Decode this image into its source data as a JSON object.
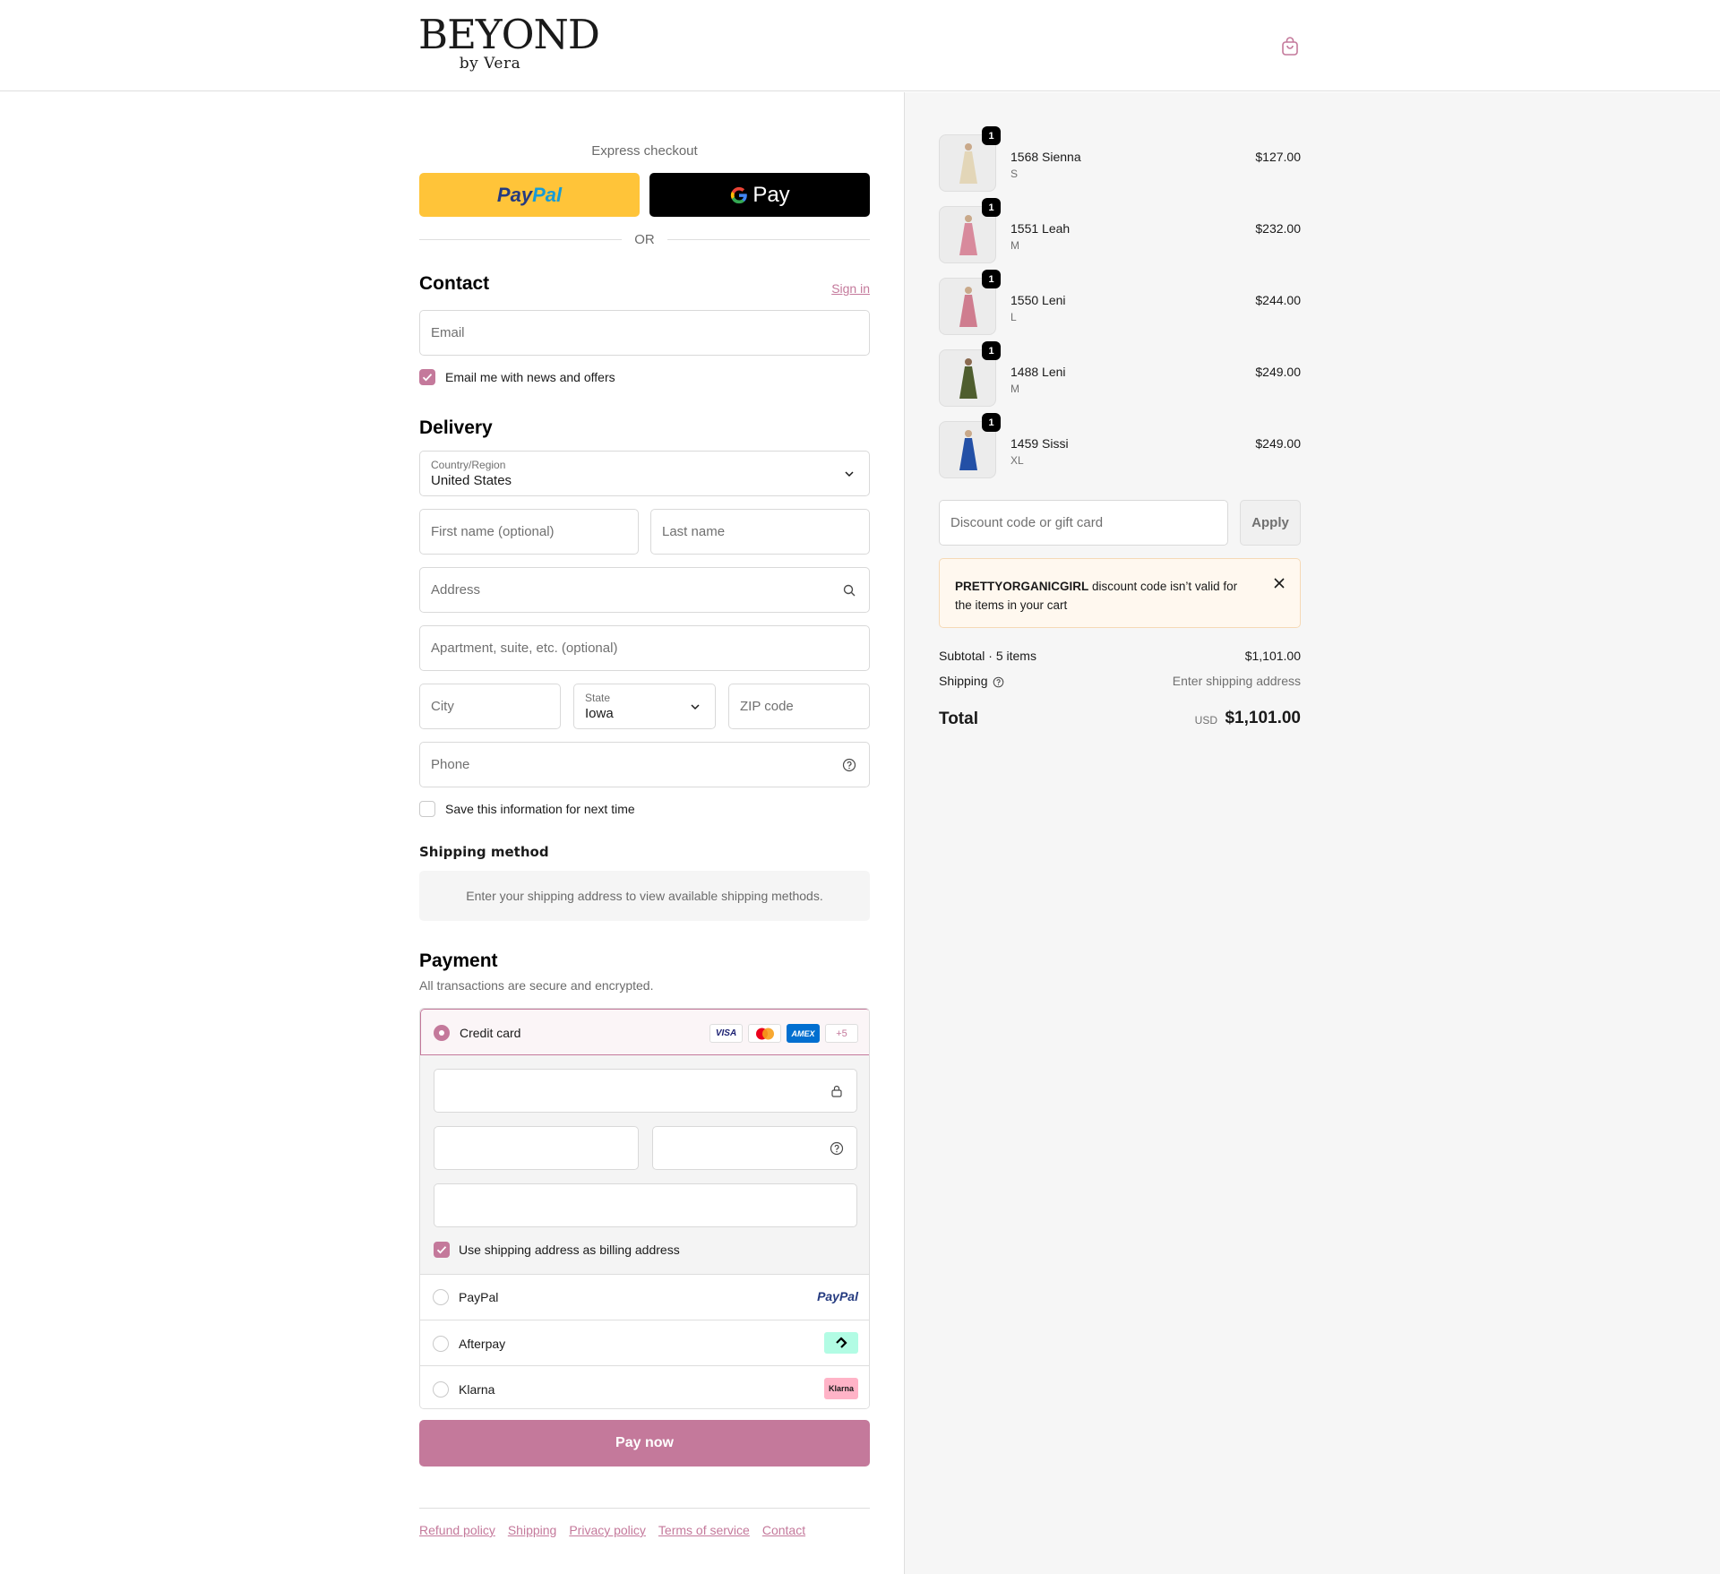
{
  "brand": {
    "name": "BEYOND",
    "tagline": "by Vera"
  },
  "express": {
    "title": "Express checkout",
    "paypal_part1": "Pay",
    "paypal_part2": "Pal",
    "gpay_label": "Pay",
    "or_label": "OR"
  },
  "contact": {
    "heading": "Contact",
    "sign_in": "Sign in",
    "email_placeholder": "Email",
    "newsletter_label": "Email me with news and offers",
    "newsletter_checked": true
  },
  "delivery": {
    "heading": "Delivery",
    "country_label": "Country/Region",
    "country_value": "United States",
    "first_name_placeholder": "First name (optional)",
    "last_name_placeholder": "Last name",
    "address_placeholder": "Address",
    "apartment_placeholder": "Apartment, suite, etc. (optional)",
    "city_placeholder": "City",
    "state_label": "State",
    "state_value": "Iowa",
    "zip_placeholder": "ZIP code",
    "phone_placeholder": "Phone",
    "save_info_label": "Save this information for next time",
    "save_info_checked": false
  },
  "shipping_method": {
    "heading": "Shipping method",
    "message": "Enter your shipping address to view available shipping methods."
  },
  "payment": {
    "heading": "Payment",
    "subtitle": "All transactions are secure and encrypted.",
    "credit_card_label": "Credit card",
    "card_brands": [
      "VISA",
      "",
      "AMEX",
      "+5"
    ],
    "billing_same_label": "Use shipping address as billing address",
    "billing_same_checked": true,
    "options": [
      {
        "label": "PayPal",
        "logo": "PayPal"
      },
      {
        "label": "Afterpay",
        "logo": "afterpay-icon"
      },
      {
        "label": "Klarna",
        "logo": "Klarna"
      }
    ],
    "pay_now": "Pay now"
  },
  "footer": {
    "links": [
      "Refund policy",
      "Shipping",
      "Privacy policy",
      "Terms of service",
      "Contact"
    ]
  },
  "order": {
    "items": [
      {
        "name": "1568 Sienna",
        "variant": "S",
        "price": "$127.00",
        "qty": "1",
        "color": "#e3d6b8"
      },
      {
        "name": "1551 Leah",
        "variant": "M",
        "price": "$232.00",
        "qty": "1",
        "color": "#d88a9c"
      },
      {
        "name": "1550 Leni",
        "variant": "L",
        "price": "$244.00",
        "qty": "1",
        "color": "#cf7d8f"
      },
      {
        "name": "1488 Leni",
        "variant": "M",
        "price": "$249.00",
        "qty": "1",
        "color": "#4f5e2f"
      },
      {
        "name": "1459 Sissi",
        "variant": "XL",
        "price": "$249.00",
        "qty": "1",
        "color": "#2350a6"
      }
    ],
    "discount_placeholder": "Discount code or gift card",
    "apply_label": "Apply",
    "alert_code": "PRETTYORGANICGIRL",
    "alert_message": " discount code isn’t valid for the items in your cart",
    "subtotal_label": "Subtotal · 5 items",
    "subtotal_value": "$1,101.00",
    "shipping_label": "Shipping",
    "shipping_value": "Enter shipping address",
    "total_label": "Total",
    "total_currency": "USD",
    "total_value": "$1,101.00"
  },
  "colors": {
    "accent": "#c4799b",
    "paypal_yellow": "#ffc439",
    "alert_bg": "#fff8ef"
  }
}
